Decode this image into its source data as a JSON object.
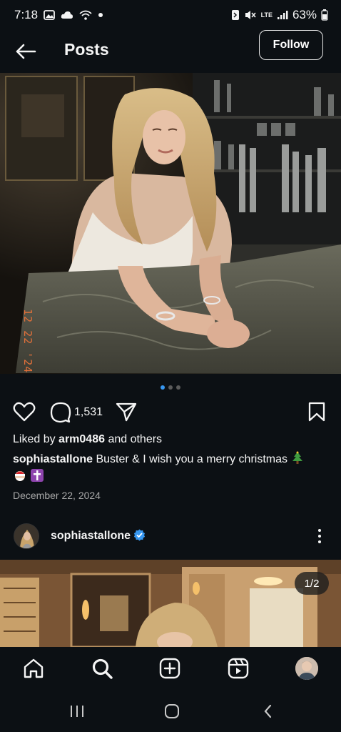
{
  "status_bar": {
    "time": "7:18",
    "battery": "63%",
    "network": "LTE"
  },
  "header": {
    "title": "Posts",
    "follow_label": "Follow"
  },
  "post": {
    "image_stamp": "12 22 '24",
    "carousel_count": 3,
    "carousel_active": 0,
    "comment_count": "1,531",
    "likes_prefix": "Liked by ",
    "likes_user": "arm0486",
    "likes_suffix": " and others",
    "caption_user": "sophiastallone",
    "caption_text": " Buster & I wish you a merry christmas ",
    "date": "December 22, 2024"
  },
  "next_post": {
    "username": "sophiastallone",
    "counter": "1/2"
  },
  "colors": {
    "background": "#0c1014",
    "accent": "#3797f0",
    "verified": "#3797f0",
    "muted": "#a8a8a8"
  },
  "icons": {
    "back": "arrow-left-icon",
    "like": "heart-icon",
    "comment": "comment-icon",
    "share": "send-icon",
    "save": "bookmark-icon",
    "home": "home-icon",
    "search": "search-icon",
    "create": "plus-square-icon",
    "reels": "reels-icon",
    "more": "more-vertical-icon"
  }
}
